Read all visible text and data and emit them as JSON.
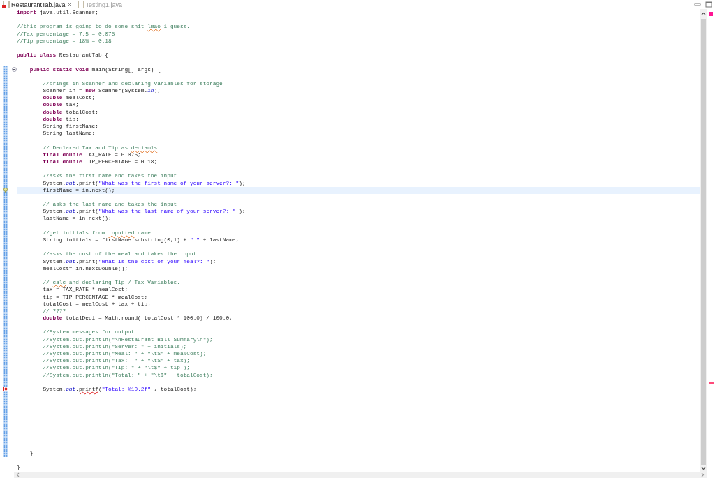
{
  "tabs": [
    {
      "label": "RestaurantTab.java",
      "selected": true,
      "closable": true,
      "error": true
    },
    {
      "label": "Testing1.java",
      "selected": false,
      "closable": false,
      "error": false
    }
  ],
  "editor": {
    "lines": [
      {
        "kind": "code",
        "changed": false,
        "current": false,
        "tokens": [
          {
            "kind": "keyword",
            "text": "import"
          },
          {
            "kind": "plain",
            "text": " java.util.Scanner;"
          }
        ]
      },
      {
        "kind": "blank"
      },
      {
        "kind": "code",
        "changed": false,
        "current": false,
        "tokens": [
          {
            "kind": "comment",
            "text": "//this program is going to do some shit "
          },
          {
            "kind": "typo",
            "text": "lmao"
          },
          {
            "kind": "comment",
            "text": " i guess."
          }
        ]
      },
      {
        "kind": "code",
        "changed": false,
        "current": false,
        "tokens": [
          {
            "kind": "comment",
            "text": "//Tax percentage = 7.5 = 0.075"
          }
        ]
      },
      {
        "kind": "code",
        "changed": false,
        "current": false,
        "tokens": [
          {
            "kind": "comment",
            "text": "//Tip percentage = 18% = 0.18"
          }
        ]
      },
      {
        "kind": "blank"
      },
      {
        "kind": "code",
        "changed": false,
        "current": false,
        "tokens": [
          {
            "kind": "keyword",
            "text": "public class"
          },
          {
            "kind": "plain",
            "text": " RestaurantTab {"
          }
        ],
        "children": [
          {
            "kind": "blank"
          },
          {
            "kind": "code",
            "changed": true,
            "current": false,
            "annotation": {
              "kind": "fold"
            },
            "tokens": [
              {
                "kind": "keyword",
                "text": "public static void"
              },
              {
                "kind": "plain",
                "text": " main(String[] args) {"
              }
            ],
            "children": [
              {
                "kind": "blank",
                "changed": true
              },
              {
                "kind": "code",
                "changed": true,
                "current": false,
                "tokens": [
                  {
                    "kind": "comment",
                    "text": "//brings in Scanner and declaring variables for storage"
                  }
                ]
              },
              {
                "kind": "code",
                "changed": true,
                "current": false,
                "tokens": [
                  {
                    "kind": "plain",
                    "text": "Scanner in = "
                  },
                  {
                    "kind": "keyword",
                    "text": "new"
                  },
                  {
                    "kind": "plain",
                    "text": " Scanner(System."
                  },
                  {
                    "kind": "field",
                    "text": "in"
                  },
                  {
                    "kind": "plain",
                    "text": ");"
                  }
                ]
              },
              {
                "kind": "code",
                "changed": true,
                "current": false,
                "tokens": [
                  {
                    "kind": "keyword",
                    "text": "double"
                  },
                  {
                    "kind": "plain",
                    "text": " mealCost;"
                  }
                ]
              },
              {
                "kind": "code",
                "changed": true,
                "current": false,
                "tokens": [
                  {
                    "kind": "keyword",
                    "text": "double"
                  },
                  {
                    "kind": "plain",
                    "text": " tax;"
                  }
                ]
              },
              {
                "kind": "code",
                "changed": true,
                "current": false,
                "tokens": [
                  {
                    "kind": "keyword",
                    "text": "double"
                  },
                  {
                    "kind": "plain",
                    "text": " totalCost;"
                  }
                ]
              },
              {
                "kind": "code",
                "changed": true,
                "current": false,
                "tokens": [
                  {
                    "kind": "keyword",
                    "text": "double"
                  },
                  {
                    "kind": "plain",
                    "text": " tip;"
                  }
                ]
              },
              {
                "kind": "code",
                "changed": true,
                "current": false,
                "tokens": [
                  {
                    "kind": "plain",
                    "text": "String firstName;"
                  }
                ]
              },
              {
                "kind": "code",
                "changed": true,
                "current": false,
                "tokens": [
                  {
                    "kind": "plain",
                    "text": "String lastName;"
                  }
                ]
              },
              {
                "kind": "blank",
                "changed": true
              },
              {
                "kind": "code",
                "changed": true,
                "current": false,
                "tokens": [
                  {
                    "kind": "comment",
                    "text": "// Declared Tax and Tip as "
                  },
                  {
                    "kind": "typo",
                    "text": "deciamls"
                  }
                ]
              },
              {
                "kind": "code",
                "changed": true,
                "current": false,
                "tokens": [
                  {
                    "kind": "keyword",
                    "text": "final double"
                  },
                  {
                    "kind": "plain",
                    "text": " TAX_RATE = 0.075;"
                  }
                ]
              },
              {
                "kind": "code",
                "changed": true,
                "current": false,
                "tokens": [
                  {
                    "kind": "keyword",
                    "text": "final double"
                  },
                  {
                    "kind": "plain",
                    "text": " TIP_PERCENTAGE = 0.18;"
                  }
                ]
              },
              {
                "kind": "blank",
                "changed": true
              },
              {
                "kind": "code",
                "changed": true,
                "current": false,
                "tokens": [
                  {
                    "kind": "comment",
                    "text": "//asks the first name and takes the input"
                  }
                ]
              },
              {
                "kind": "code",
                "changed": true,
                "current": false,
                "tokens": [
                  {
                    "kind": "plain",
                    "text": "System."
                  },
                  {
                    "kind": "field",
                    "text": "out"
                  },
                  {
                    "kind": "plain",
                    "text": ".print("
                  },
                  {
                    "kind": "string",
                    "text": "\"What was the first name of your server?: \""
                  },
                  {
                    "kind": "plain",
                    "text": ");"
                  }
                ]
              },
              {
                "kind": "code",
                "changed": true,
                "current": true,
                "annotation": {
                  "kind": "warning"
                },
                "tokens": [
                  {
                    "kind": "plain",
                    "text": "firstName = in.next();"
                  }
                ]
              },
              {
                "kind": "blank",
                "changed": true
              },
              {
                "kind": "code",
                "changed": true,
                "current": false,
                "tokens": [
                  {
                    "kind": "comment",
                    "text": "// asks the last name and takes the input"
                  }
                ]
              },
              {
                "kind": "code",
                "changed": true,
                "current": false,
                "tokens": [
                  {
                    "kind": "plain",
                    "text": "System."
                  },
                  {
                    "kind": "field",
                    "text": "out"
                  },
                  {
                    "kind": "plain",
                    "text": ".print("
                  },
                  {
                    "kind": "string",
                    "text": "\"What was the last name of your server?: \""
                  },
                  {
                    "kind": "plain",
                    "text": " );"
                  }
                ]
              },
              {
                "kind": "code",
                "changed": true,
                "current": false,
                "tokens": [
                  {
                    "kind": "plain",
                    "text": "lastName = in.next();"
                  }
                ]
              },
              {
                "kind": "blank",
                "changed": true
              },
              {
                "kind": "code",
                "changed": true,
                "current": false,
                "tokens": [
                  {
                    "kind": "comment",
                    "text": "//get initials from "
                  },
                  {
                    "kind": "typo",
                    "text": "inputted"
                  },
                  {
                    "kind": "comment",
                    "text": " name"
                  }
                ]
              },
              {
                "kind": "code",
                "changed": true,
                "current": false,
                "tokens": [
                  {
                    "kind": "plain",
                    "text": "String initials = firstName.substring(0,1) + "
                  },
                  {
                    "kind": "string",
                    "text": "\".\""
                  },
                  {
                    "kind": "plain",
                    "text": " + lastName;"
                  }
                ]
              },
              {
                "kind": "blank",
                "changed": true
              },
              {
                "kind": "code",
                "changed": true,
                "current": false,
                "tokens": [
                  {
                    "kind": "comment",
                    "text": "//asks the cost of the meal and takes the input"
                  }
                ]
              },
              {
                "kind": "code",
                "changed": true,
                "current": false,
                "tokens": [
                  {
                    "kind": "plain",
                    "text": "System."
                  },
                  {
                    "kind": "field",
                    "text": "out"
                  },
                  {
                    "kind": "plain",
                    "text": ".print("
                  },
                  {
                    "kind": "string",
                    "text": "\"What is the cost of your meal?: \""
                  },
                  {
                    "kind": "plain",
                    "text": ");"
                  }
                ]
              },
              {
                "kind": "code",
                "changed": true,
                "current": false,
                "tokens": [
                  {
                    "kind": "plain",
                    "text": "mealCost= in.nextDouble();"
                  }
                ]
              },
              {
                "kind": "blank",
                "changed": true
              },
              {
                "kind": "code",
                "changed": true,
                "current": false,
                "tokens": [
                  {
                    "kind": "comment",
                    "text": "// "
                  },
                  {
                    "kind": "typo",
                    "text": "calc"
                  },
                  {
                    "kind": "comment",
                    "text": " and declaring Tip / Tax Variables."
                  }
                ]
              },
              {
                "kind": "code",
                "changed": true,
                "current": false,
                "tokens": [
                  {
                    "kind": "plain",
                    "text": "tax = TAX_RATE * mealCost;"
                  }
                ]
              },
              {
                "kind": "code",
                "changed": true,
                "current": false,
                "tokens": [
                  {
                    "kind": "plain",
                    "text": "tip = TIP_PERCENTAGE * mealCost;"
                  }
                ]
              },
              {
                "kind": "code",
                "changed": true,
                "current": false,
                "tokens": [
                  {
                    "kind": "plain",
                    "text": "totalCost = mealCost + tax + tip;"
                  }
                ]
              },
              {
                "kind": "code",
                "changed": true,
                "current": false,
                "tokens": [
                  {
                    "kind": "comment",
                    "text": "// ????"
                  }
                ]
              },
              {
                "kind": "code",
                "changed": true,
                "current": false,
                "tokens": [
                  {
                    "kind": "keyword",
                    "text": "double"
                  },
                  {
                    "kind": "plain",
                    "text": " totalDeci = Math.round( totalCost * 100.0) / 100.0;"
                  }
                ]
              },
              {
                "kind": "blank",
                "changed": true
              },
              {
                "kind": "code",
                "changed": true,
                "current": false,
                "tokens": [
                  {
                    "kind": "comment",
                    "text": "//System messages for output"
                  }
                ]
              },
              {
                "kind": "code",
                "changed": true,
                "current": false,
                "tokens": [
                  {
                    "kind": "comment",
                    "text": "//System.out.println(\"\\nRestaurant Bill Summary\\n\");"
                  }
                ]
              },
              {
                "kind": "code",
                "changed": true,
                "current": false,
                "tokens": [
                  {
                    "kind": "comment",
                    "text": "//System.out.println(\"Server: \" + initials);"
                  }
                ]
              },
              {
                "kind": "code",
                "changed": true,
                "current": false,
                "tokens": [
                  {
                    "kind": "comment",
                    "text": "//System.out.println(\"Meal: \" + \"\\t$\" + mealCost);"
                  }
                ]
              },
              {
                "kind": "code",
                "changed": true,
                "current": false,
                "tokens": [
                  {
                    "kind": "comment",
                    "text": "//System.out.println(\"Tax:  \" + \"\\t$\" + tax);"
                  }
                ]
              },
              {
                "kind": "code",
                "changed": true,
                "current": false,
                "tokens": [
                  {
                    "kind": "comment",
                    "text": "//System.out.println(\"Tip: \" + \"\\t$\" + tip );"
                  }
                ]
              },
              {
                "kind": "code",
                "changed": true,
                "current": false,
                "tokens": [
                  {
                    "kind": "comment",
                    "text": "//System.out.println(\"Total: \" + \"\\t$\" + totalCost);"
                  }
                ]
              },
              {
                "kind": "blank",
                "changed": true
              },
              {
                "kind": "code",
                "changed": true,
                "current": false,
                "annotation": {
                  "kind": "error"
                },
                "tokens": [
                  {
                    "kind": "plain",
                    "text": "System."
                  },
                  {
                    "kind": "field",
                    "text": "out"
                  },
                  {
                    "kind": "plain",
                    "text": "."
                  },
                  {
                    "kind": "error",
                    "text": "printf"
                  },
                  {
                    "kind": "plain",
                    "text": "("
                  },
                  {
                    "kind": "string",
                    "text": "\"Total: %10.2f\""
                  },
                  {
                    "kind": "plain",
                    "text": " , totalCost);"
                  }
                ]
              },
              {
                "kind": "blank",
                "changed": true
              },
              {
                "kind": "blank",
                "changed": true
              },
              {
                "kind": "blank",
                "changed": true
              },
              {
                "kind": "blank",
                "changed": true
              },
              {
                "kind": "blank",
                "changed": true
              },
              {
                "kind": "blank",
                "changed": true
              },
              {
                "kind": "blank",
                "changed": true
              },
              {
                "kind": "blank",
                "changed": true
              }
            ]
          },
          {
            "kind": "code",
            "changed": true,
            "current": false,
            "tokens": [
              {
                "kind": "plain",
                "text": "}"
              }
            ]
          },
          {
            "kind": "blank"
          }
        ]
      },
      {
        "kind": "code",
        "changed": false,
        "current": false,
        "tokens": [
          {
            "kind": "plain",
            "text": "}"
          }
        ]
      }
    ]
  }
}
